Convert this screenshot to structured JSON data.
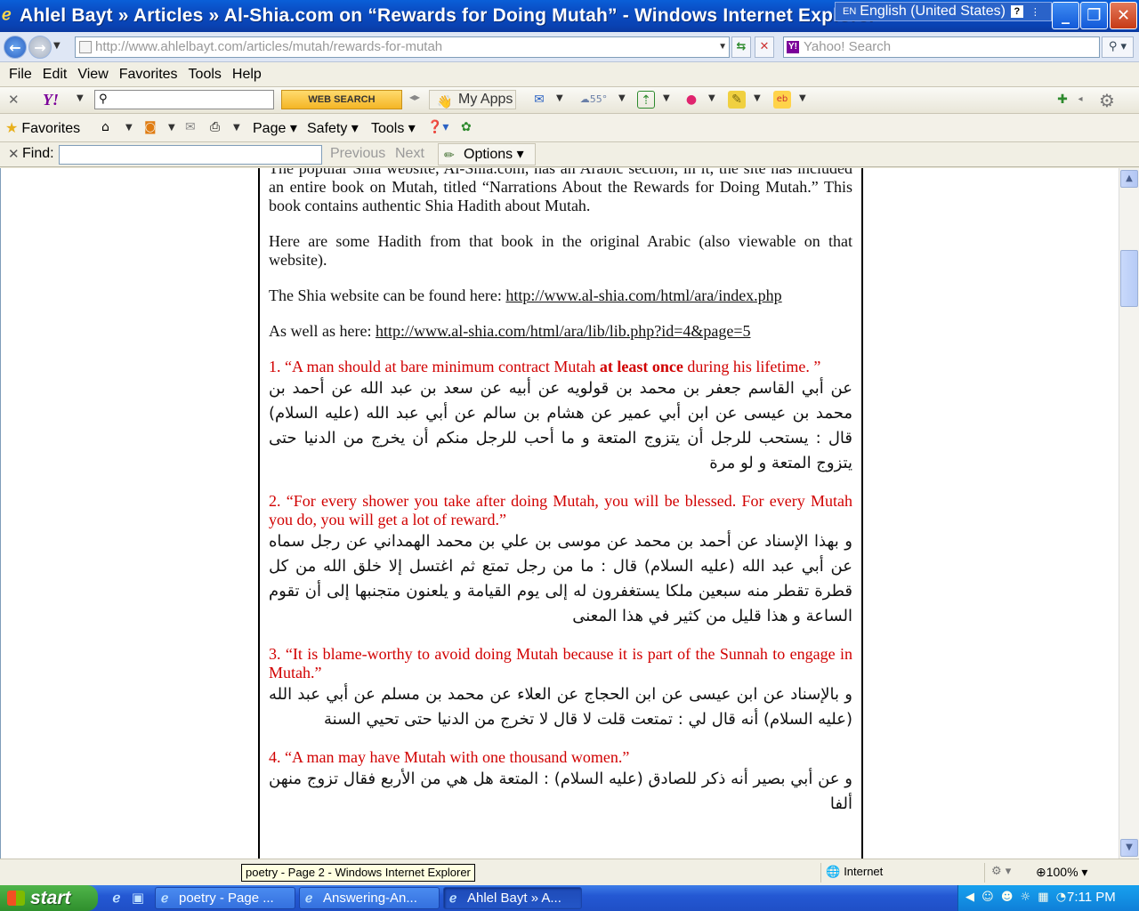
{
  "window": {
    "title": "Ahlel Bayt » Articles » Al-Shia.com on “Rewards for Doing Mutah” - Windows Internet Explorer",
    "minimize": "_",
    "maximize": "❐",
    "close": "✕"
  },
  "language_bar": {
    "code": "EN",
    "language": "English (United States)",
    "help": "?"
  },
  "address_bar": {
    "url": "http://www.ahlelbayt.com/articles/mutah/rewards-for-mutah",
    "search_placeholder": "Yahoo! Search"
  },
  "menu": [
    "File",
    "Edit",
    "View",
    "Favorites",
    "Tools",
    "Help"
  ],
  "yahoo_toolbar": {
    "logo": "Y!",
    "web_search_label": "WEB SEARCH",
    "my_apps_label": "My Apps",
    "weather_temp": "55°"
  },
  "command_bar": {
    "favorites_label": "Favorites",
    "page_label": "Page",
    "safety_label": "Safety",
    "tools_label": "Tools"
  },
  "find_bar": {
    "label": "Find:",
    "value": "",
    "previous_label": "Previous",
    "next_label": "Next",
    "options_label": "Options"
  },
  "content": {
    "intro": "The popular Shia website, Al-Shia.com, has an Arabic section; in it, the site has included an entire book on Mutah, titled “Narrations About the Rewards for Doing Mutah.” This book contains authentic Shia Hadith about Mutah.",
    "here_are": "Here are some Hadith from that book in the original Arabic (also viewable on that website).",
    "found_here_prefix": "The Shia website can be found here: ",
    "link1": "http://www.al-shia.com/html/ara/index.php",
    "as_well_prefix": "As well as here: ",
    "link2": "http://www.al-shia.com/html/ara/lib/lib.php?id=4&page=5",
    "hadith": [
      {
        "english_before": "1. “A man should at bare minimum contract Mutah ",
        "english_bold": "at least once",
        "english_after": " during his lifetime. ”",
        "arabic": "عن أبي القاسم جعفر بن محمد بن قولويه عن أبيه عن سعد بن عبد الله عن أحمد بن محمد بن عيسى عن ابن أبي عمير عن هشام بن سالم عن أبي عبد الله (عليه السلام) قال : يستحب للرجل أن يتزوج المتعة و ما أحب للرجل منكم أن يخرج من الدنيا حتى يتزوج المتعة و لو مرة"
      },
      {
        "english": "2. “For every shower you take after doing Mutah, you will be blessed. For every Mutah you do, you will get a lot of reward.”",
        "arabic": "و بهذا الإسناد عن أحمد بن محمد عن موسى بن علي بن محمد الهمداني عن رجل سماه عن أبي عبد الله (عليه السلام) قال : ما من رجل تمتع ثم اغتسل إلا خلق الله من كل قطرة تقطر منه سبعين ملكا يستغفرون له إلى يوم القيامة و يلعنون متجنبها إلى أن تقوم الساعة و هذا قليل من كثير في هذا المعنى"
      },
      {
        "english": "3. “It is blame-worthy to avoid doing Mutah because it is part of the Sunnah to engage in Mutah.”",
        "arabic": "و بالإسناد عن ابن عيسى عن ابن الحجاج عن العلاء عن محمد بن مسلم عن أبي عبد الله (عليه السلام) أنه قال لي : تمتعت قلت لا قال لا تخرج من الدنيا حتى تحيي السنة"
      },
      {
        "english": "4. “A man may have Mutah with one thousand women.”",
        "arabic": "و عن أبي بصير أنه ذكر للصادق (عليه السلام) : المتعة هل هي من الأربع فقال تزوج منهن ألفا"
      }
    ]
  },
  "status_bar": {
    "tooltip": "poetry - Page 2 - Windows Internet Explorer",
    "zone": "Internet",
    "zoom": "100%"
  },
  "taskbar": {
    "start_label": "start",
    "buttons": [
      "poetry - Page ...",
      "Answering-An...",
      "Ahlel Bayt » A..."
    ],
    "clock": "7:11 PM"
  }
}
